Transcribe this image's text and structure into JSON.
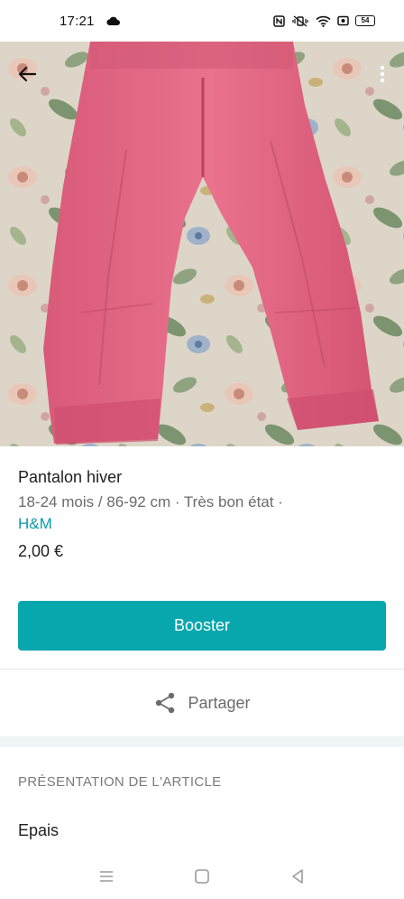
{
  "status_bar": {
    "time": "17:21",
    "battery": "54"
  },
  "listing": {
    "title": "Pantalon hiver",
    "meta": "18-24 mois / 86-92 cm · Très bon état ·",
    "brand": "H&M",
    "price": "2,00 €"
  },
  "actions": {
    "booster_label": "Booster",
    "share_label": "Partager"
  },
  "description_section": {
    "heading": "PRÉSENTATION DE L'ARTICLE",
    "text": "Epais"
  },
  "colors": {
    "accent": "#08a6ad",
    "link": "#0b9aa6",
    "product": "#e2647f"
  },
  "icons": {
    "back": "arrow-left-icon",
    "more": "more-vertical-icon",
    "share": "share-icon",
    "nav_menu": "menu-icon",
    "nav_home": "home-square-icon",
    "nav_back": "back-triangle-icon"
  }
}
